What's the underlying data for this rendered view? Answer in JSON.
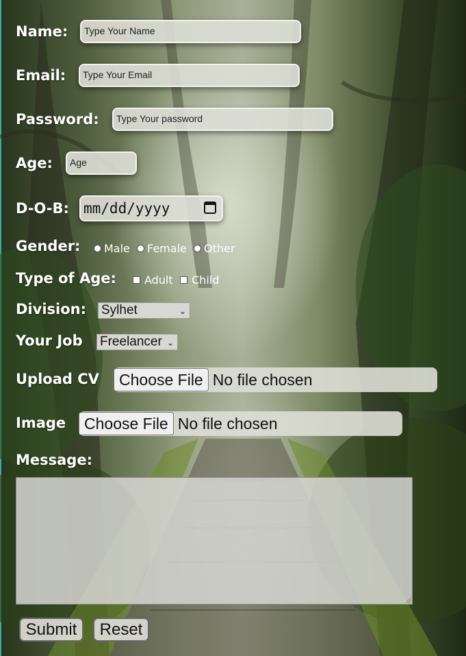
{
  "form": {
    "name": {
      "label": "Name:",
      "placeholder": "Type Your Name"
    },
    "email": {
      "label": "Email:",
      "placeholder": "Type Your Email"
    },
    "password": {
      "label": "Password:",
      "placeholder": "Type Your password"
    },
    "age": {
      "label": "Age:",
      "placeholder": "Age"
    },
    "dob": {
      "label": "D-O-B:",
      "placeholder": "mm/dd/yyyy"
    },
    "gender": {
      "label": "Gender:",
      "options": [
        "Male",
        "Female",
        "Other"
      ]
    },
    "type_of_age": {
      "label": "Type of Age:",
      "options": [
        "Adult",
        "Child"
      ]
    },
    "division": {
      "label": "Division:",
      "selected": "Sylhet"
    },
    "job": {
      "label": "Your Job",
      "selected": "Freelancer"
    },
    "cv": {
      "label": "Upload CV",
      "button": "Choose File",
      "status": "No file chosen"
    },
    "image": {
      "label": "Image",
      "button": "Choose File",
      "status": "No file chosen"
    },
    "message": {
      "label": "Message:",
      "value": ""
    },
    "submit_label": "Submit",
    "reset_label": "Reset"
  }
}
